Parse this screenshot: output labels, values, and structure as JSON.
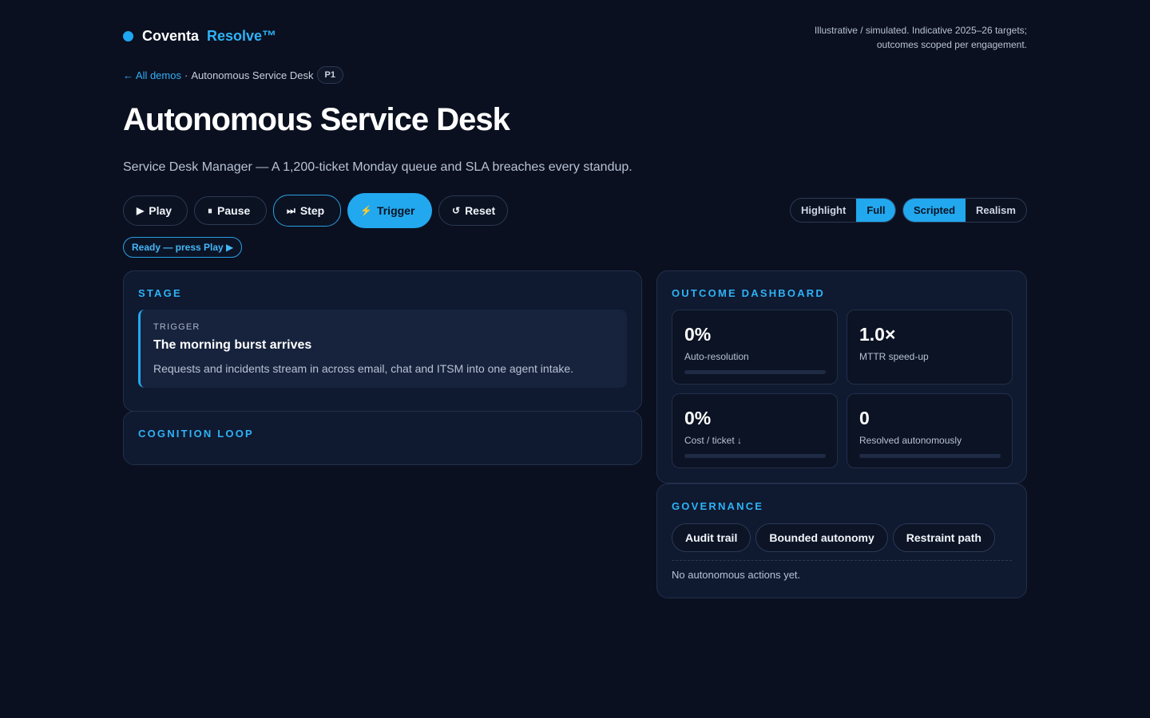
{
  "brand": {
    "name": "Coventa",
    "product": "Resolve™",
    "accent": "#1fa7f0"
  },
  "disclaimer": {
    "line1": "Illustrative / simulated. Indicative 2025–26 targets;",
    "line2": "outcomes scoped per engagement."
  },
  "breadcrumb": {
    "back": "← All demos",
    "separator": "·",
    "current": "Autonomous Service Desk",
    "badge": "P1"
  },
  "page": {
    "title": "Autonomous Service Desk",
    "subtitle": "Service Desk Manager — A 1,200-ticket Monday queue and SLA breaches every standup."
  },
  "controls": {
    "play": {
      "icon": "▶",
      "label": "Play"
    },
    "pause": {
      "icon": "⏸",
      "label": "Pause"
    },
    "step": {
      "icon": "⏭",
      "label": "Step"
    },
    "trigger": {
      "icon": "⚡",
      "label": "Trigger"
    },
    "reset": {
      "icon": "↺",
      "label": "Reset"
    }
  },
  "view_toggle": {
    "options": [
      "Highlight",
      "Full"
    ],
    "selected": "Full"
  },
  "mode_toggle": {
    "options": [
      "Scripted",
      "Realism"
    ],
    "selected": "Scripted"
  },
  "status": "Ready — press Play ▶",
  "stage": {
    "heading": "STAGE",
    "card": {
      "kicker": "TRIGGER",
      "title": "The morning burst arrives",
      "description": "Requests and incidents stream in across email, chat and ITSM into one agent intake."
    }
  },
  "cognition": {
    "heading": "COGNITION LOOP"
  },
  "dashboard": {
    "heading": "OUTCOME DASHBOARD",
    "metrics": [
      {
        "value": "0%",
        "label": "Auto-resolution",
        "progress": 0
      },
      {
        "value": "1.0×",
        "label": "MTTR speed-up"
      },
      {
        "value": "0%",
        "label": "Cost / ticket ↓",
        "progress": 0
      },
      {
        "value": "0",
        "label": "Resolved autonomously",
        "progress": 0
      }
    ]
  },
  "governance": {
    "heading": "GOVERNANCE",
    "chips": [
      "Audit trail",
      "Bounded autonomy",
      "Restraint path"
    ],
    "note": "No autonomous actions yet."
  }
}
